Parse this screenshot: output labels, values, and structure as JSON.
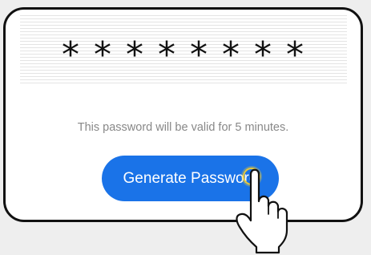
{
  "password": {
    "masked_value": "* * * * * * * *"
  },
  "validity": {
    "text": "This password will be valid for 5 minutes."
  },
  "generate_button": {
    "label": "Generate Password"
  },
  "colors": {
    "button_blue": "#1a73e8",
    "validity_gray": "#888888",
    "tap_ring": "#e8c93a"
  },
  "icons": {
    "cursor": "pointing-hand-icon"
  }
}
